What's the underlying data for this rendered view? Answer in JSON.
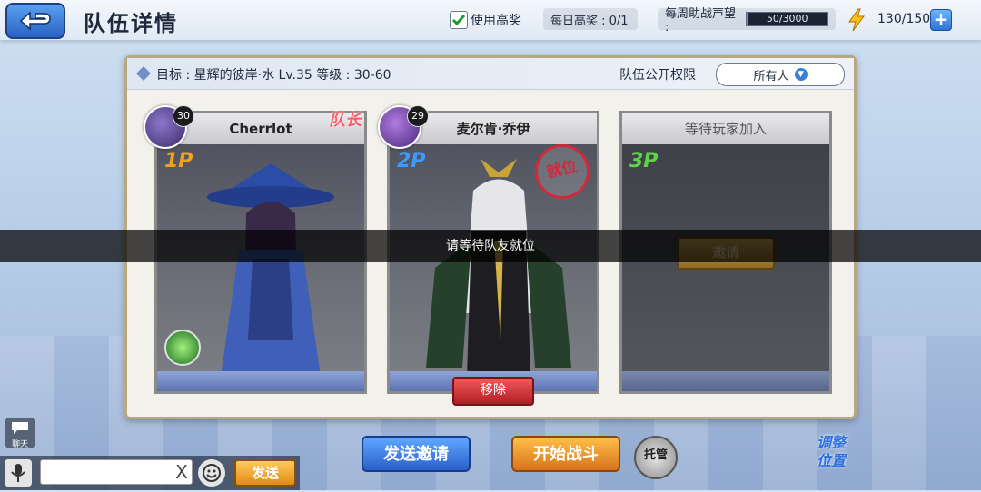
{
  "header": {
    "title": "队伍详情",
    "use_high_reward_label": "使用高奖",
    "daily_high_reward": "每日高奖 : 0/1",
    "weekly_assist_label": "每周助战声望 :",
    "weekly_assist_value": "50/3000",
    "weekly_assist_progress": 0.017,
    "stamina": "130/150",
    "use_high_reward_checked": true
  },
  "panel": {
    "goal": "目标 : 星辉的彼岸·水  Lv.35     等级 : 30-60",
    "permission_label": "队伍公开权限",
    "permission_value": "所有人"
  },
  "slots": [
    {
      "name": "Cherrlot",
      "level": "30",
      "player": "1P",
      "leader_tag": "队长"
    },
    {
      "name": "麦尔肯·乔伊",
      "level": "29",
      "player": "2P",
      "ready_stamp": "就位",
      "remove_label": "移除"
    },
    {
      "name": "等待玩家加入",
      "player": "3P",
      "invite_label": "邀请"
    }
  ],
  "banner": "请等待队友就位",
  "bottom": {
    "send_invite": "发送邀请",
    "start_battle": "开始战斗",
    "auto": "托管",
    "adjust_line1": "调整",
    "adjust_line2": "位置",
    "chat_label": "聊天",
    "send": "发送",
    "clear": "X"
  },
  "colors": {
    "accent_blue": "#2b5fc9",
    "start_orange": "#d8731a",
    "remove_red": "#b11d24"
  }
}
